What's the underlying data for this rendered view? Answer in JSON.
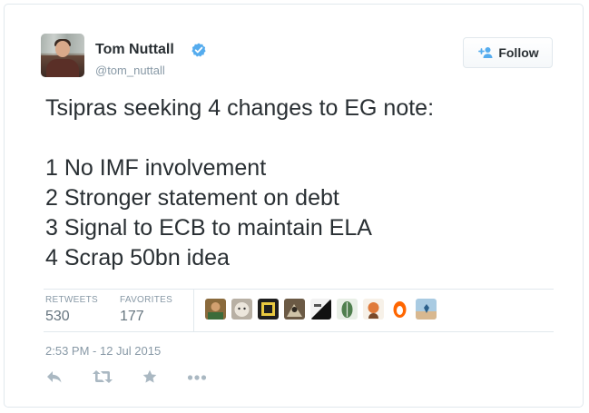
{
  "tweet": {
    "author": {
      "name": "Tom Nuttall",
      "handle": "@tom_nuttall",
      "verified": true,
      "avatar_icon": "avatar-photo"
    },
    "follow_button": {
      "label": "Follow",
      "icon": "follow-user-icon"
    },
    "text_lines": [
      "Tsipras seeking 4 changes to EG note:",
      "",
      "1 No IMF involvement",
      "2 Stronger statement on debt",
      "3 Signal to ECB to maintain ELA",
      "4 Scrap 50bn idea"
    ],
    "stats": {
      "retweets_label": "RETWEETS",
      "retweets_count": "530",
      "favorites_label": "FAVORITES",
      "favorites_count": "177"
    },
    "favoriter_avatars_count": 9,
    "timestamp": "2:53 PM - 12 Jul 2015",
    "actions": [
      "reply-icon",
      "retweet-icon",
      "favorite-icon",
      "more-icon"
    ]
  },
  "colors": {
    "text": "#292f33",
    "muted": "#8899a6",
    "verified_blue": "#55acee",
    "border": "#e1e8ed"
  }
}
